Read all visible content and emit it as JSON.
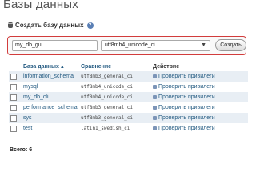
{
  "page": {
    "title": "Базы данных"
  },
  "create_db": {
    "label": "Создать базу данных",
    "db_name_value": "my_db_gui",
    "collation_value": "utf8mb4_unicode_ci",
    "create_button_label": "Создать"
  },
  "table": {
    "headers": {
      "name": "База данных",
      "collation": "Сравнение",
      "action": "Действие"
    },
    "rows": [
      {
        "name": "information_schema",
        "collation": "utf8mb3_general_ci",
        "action": "Проверить привилеги"
      },
      {
        "name": "mysql",
        "collation": "utf8mb4_unicode_ci",
        "action": "Проверить привилеги"
      },
      {
        "name": "my_db_cli",
        "collation": "utf8mb4_unicode_ci",
        "action": "Проверить привилеги"
      },
      {
        "name": "performance_schema",
        "collation": "utf8mb3_general_ci",
        "action": "Проверить привилеги"
      },
      {
        "name": "sys",
        "collation": "utf8mb3_general_ci",
        "action": "Проверить привилеги"
      },
      {
        "name": "test",
        "collation": "latin1_swedish_ci",
        "action": "Проверить привилеги"
      }
    ]
  },
  "footer": {
    "total": "Всего: 6"
  },
  "colors": {
    "highlight_border": "#d23c3c",
    "link": "#235a81",
    "row_alt": "#e8eef4"
  }
}
